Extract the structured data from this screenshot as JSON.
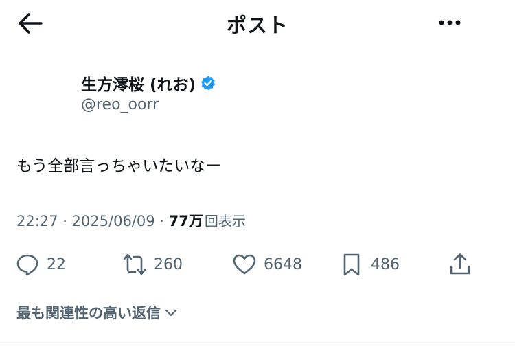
{
  "header": {
    "title": "ポスト"
  },
  "author": {
    "name": "生方澪桜 (れお)",
    "handle": "@reo_oorr",
    "verified": true
  },
  "post": {
    "text": "もう全部言っちゃいたいなー",
    "time": "22:27",
    "separator1": " · ",
    "date": "2025/06/09",
    "separator2": " · ",
    "views_count": "77万",
    "views_label": "回表示"
  },
  "actions": {
    "replies": "22",
    "reposts": "260",
    "likes": "6648",
    "bookmarks": "486"
  },
  "replies_sort": {
    "label": "最も関連性の高い返信"
  },
  "colors": {
    "text": "#0f1419",
    "secondary": "#536471",
    "verified_blue": "#1d9bf0"
  },
  "icons": [
    "back-arrow-icon",
    "more-dots-icon",
    "verified-badge-icon",
    "reply-icon",
    "repost-icon",
    "like-icon",
    "bookmark-icon",
    "share-icon",
    "chevron-down-icon"
  ]
}
